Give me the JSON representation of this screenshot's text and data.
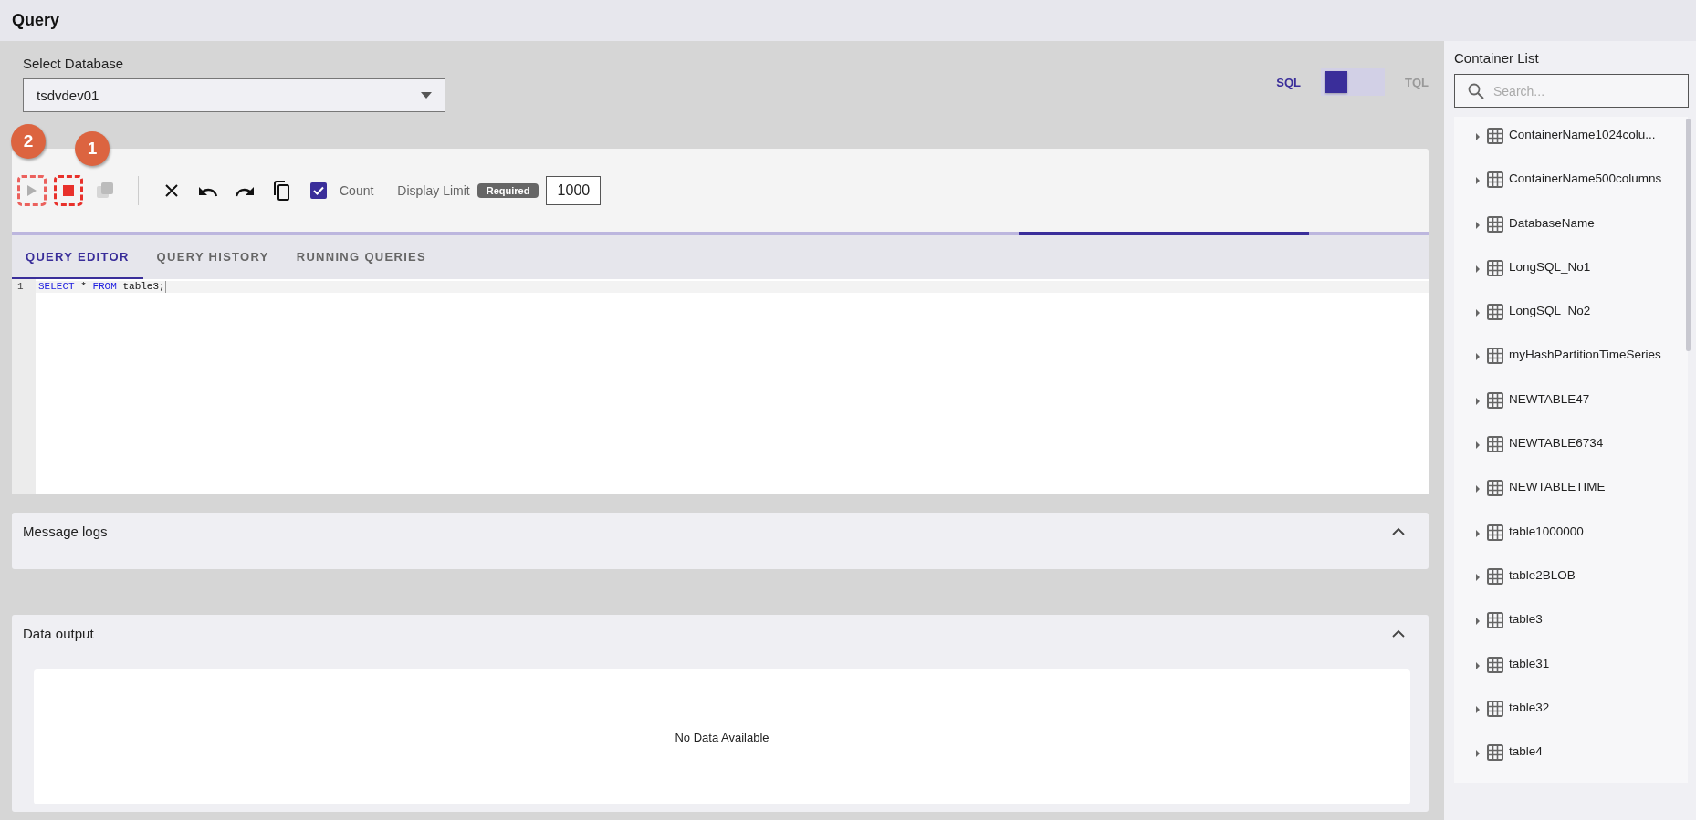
{
  "header": {
    "title": "Query"
  },
  "database": {
    "label": "Select Database",
    "value": "tsdvdev01"
  },
  "mode_toggle": {
    "options": [
      {
        "label": "SQL",
        "selected": true
      },
      {
        "label": "TQL",
        "selected": false
      }
    ]
  },
  "annotations": [
    {
      "label": "2"
    },
    {
      "label": "1"
    }
  ],
  "toolbar": {
    "run_buttons": [
      {
        "kind": "run",
        "disabled": true,
        "highlighted": true
      },
      {
        "kind": "stop",
        "disabled": false,
        "highlighted": true
      },
      {
        "kind": "stack",
        "disabled": true,
        "highlighted": false
      }
    ],
    "edit_buttons": [
      {
        "kind": "clear"
      },
      {
        "kind": "undo"
      },
      {
        "kind": "redo"
      },
      {
        "kind": "copy"
      }
    ],
    "count": {
      "label": "Count",
      "checked": true
    },
    "display_limit": {
      "label": "Display Limit",
      "badge": "Required",
      "value": "1000"
    }
  },
  "tabs": [
    {
      "label": "QUERY EDITOR",
      "selected": true
    },
    {
      "label": "QUERY HISTORY",
      "selected": false
    },
    {
      "label": "RUNNING QUERIES",
      "selected": false
    }
  ],
  "editor": {
    "lines": [
      {
        "number": "1",
        "tokens": [
          {
            "text": "SELECT",
            "kind": "keyword"
          },
          {
            "text": " * ",
            "kind": "plain"
          },
          {
            "text": "FROM",
            "kind": "keyword"
          },
          {
            "text": " table3;",
            "kind": "plain"
          }
        ]
      }
    ]
  },
  "panels": [
    {
      "title": "Message logs",
      "expanded": true
    },
    {
      "title": "Data output",
      "expanded": true,
      "empty_text": "No Data Available"
    }
  ],
  "sidebar": {
    "title": "Container List",
    "search": {
      "placeholder": "Search..."
    },
    "items": [
      {
        "name": "ContainerName1024colu...",
        "expanded": false
      },
      {
        "name": "ContainerName500columns",
        "expanded": false
      },
      {
        "name": "DatabaseName",
        "expanded": false
      },
      {
        "name": "LongSQL_No1",
        "expanded": false
      },
      {
        "name": "LongSQL_No2",
        "expanded": false
      },
      {
        "name": "myHashPartitionTimeSeries",
        "expanded": false
      },
      {
        "name": "NEWTABLE47",
        "expanded": false
      },
      {
        "name": "NEWTABLE6734",
        "expanded": false
      },
      {
        "name": "NEWTABLETIME",
        "expanded": false
      },
      {
        "name": "table1000000",
        "expanded": false
      },
      {
        "name": "table2BLOB",
        "expanded": false
      },
      {
        "name": "table3",
        "expanded": false
      },
      {
        "name": "table31",
        "expanded": false
      },
      {
        "name": "table32",
        "expanded": false
      },
      {
        "name": "table4",
        "expanded": false
      }
    ]
  }
}
